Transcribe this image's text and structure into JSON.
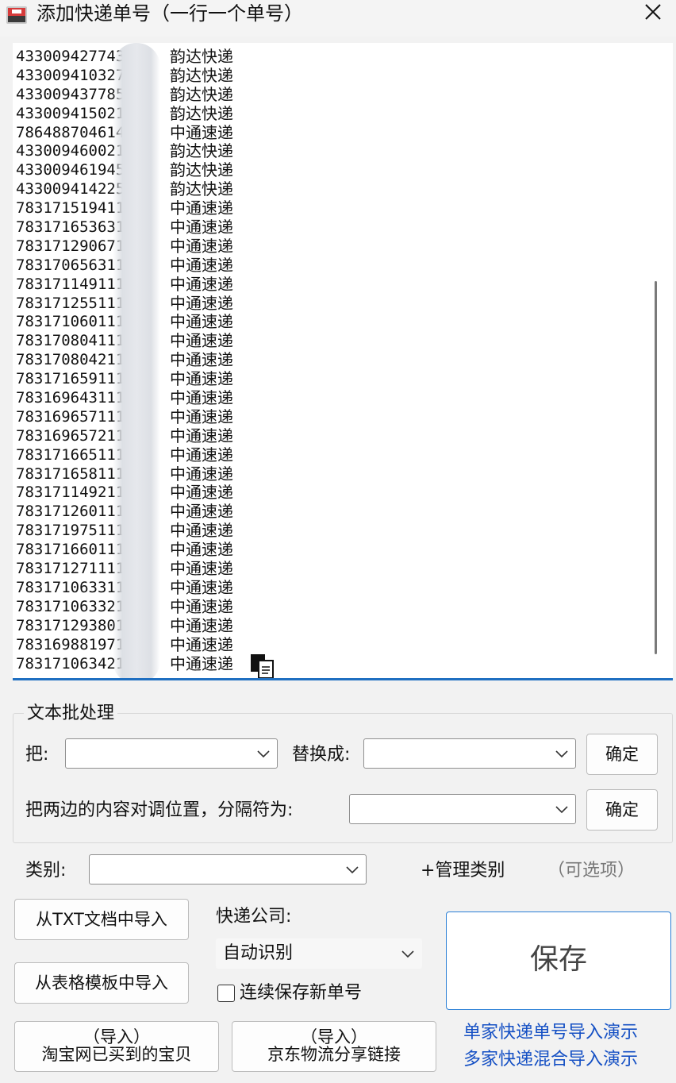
{
  "window": {
    "title": "添加快递单号（一行一个单号）",
    "close_glyph": "✕"
  },
  "editor": {
    "lines": [
      {
        "number": "433009427743",
        "courier": "韵达快递"
      },
      {
        "number": "433009410327",
        "courier": "韵达快递"
      },
      {
        "number": "433009437785",
        "courier": "韵达快递"
      },
      {
        "number": "433009415021",
        "courier": "韵达快递"
      },
      {
        "number": "786488704614",
        "courier": "中通速递"
      },
      {
        "number": "433009460021",
        "courier": "韵达快递"
      },
      {
        "number": "433009461945",
        "courier": "韵达快递"
      },
      {
        "number": "433009414225",
        "courier": "韵达快递"
      },
      {
        "number": "783171519411",
        "courier": "中通速递"
      },
      {
        "number": "783171653631",
        "courier": "中通速递"
      },
      {
        "number": "783171290671",
        "courier": "中通速递"
      },
      {
        "number": "783170656311",
        "courier": "中通速递"
      },
      {
        "number": "783171149111",
        "courier": "中通速递"
      },
      {
        "number": "783171255111",
        "courier": "中通速递"
      },
      {
        "number": "783171060111",
        "courier": "中通速递"
      },
      {
        "number": "783170804111",
        "courier": "中通速递"
      },
      {
        "number": "783170804211",
        "courier": "中通速递"
      },
      {
        "number": "783171659111",
        "courier": "中通速递"
      },
      {
        "number": "783169643111",
        "courier": "中通速递"
      },
      {
        "number": "783169657111",
        "courier": "中通速递"
      },
      {
        "number": "783169657211",
        "courier": "中通速递"
      },
      {
        "number": "783171665111",
        "courier": "中通速递"
      },
      {
        "number": "783171658111",
        "courier": "中通速递"
      },
      {
        "number": "783171149211",
        "courier": "中通速递"
      },
      {
        "number": "783171260111",
        "courier": "中通速递"
      },
      {
        "number": "783171975111",
        "courier": "中通速递"
      },
      {
        "number": "783171660111",
        "courier": "中通速递"
      },
      {
        "number": "783171271111",
        "courier": "中通速递"
      },
      {
        "number": "783171063311",
        "courier": "中通速递"
      },
      {
        "number": "783171063321",
        "courier": "中通速递"
      },
      {
        "number": "783171293801",
        "courier": "中通速递"
      },
      {
        "number": "783169881971",
        "courier": "中通速递"
      },
      {
        "number": "783171063421",
        "courier": "中通速递"
      }
    ]
  },
  "batch": {
    "group_title": "文本批处理",
    "replace_from_label": "把:",
    "replace_to_label": "替换成:",
    "confirm_label": "确定",
    "swap_label": "把两边的内容对调位置，分隔符为:",
    "confirm2_label": "确定"
  },
  "category": {
    "label": "类别:",
    "manage_label": "+管理类别",
    "optional_hint": "（可选项）"
  },
  "import": {
    "txt_button": "从TXT文档中导入",
    "table_button": "从表格模板中导入",
    "taobao_line1": "（导入）",
    "taobao_line2": "淘宝网已买到的宝贝",
    "jd_line1": "（导入）",
    "jd_line2": "京东物流分享链接"
  },
  "courier": {
    "label": "快递公司:",
    "selected": "自动识别",
    "continuous_checkbox_label": "连续保存新单号",
    "continuous_checked": false
  },
  "save_button": "保存",
  "links": {
    "single_demo": "单家快递单号导入演示",
    "multi_demo": "多家快递混合导入演示"
  },
  "colors": {
    "accent": "#1f6fc1",
    "link": "#1550c4"
  }
}
